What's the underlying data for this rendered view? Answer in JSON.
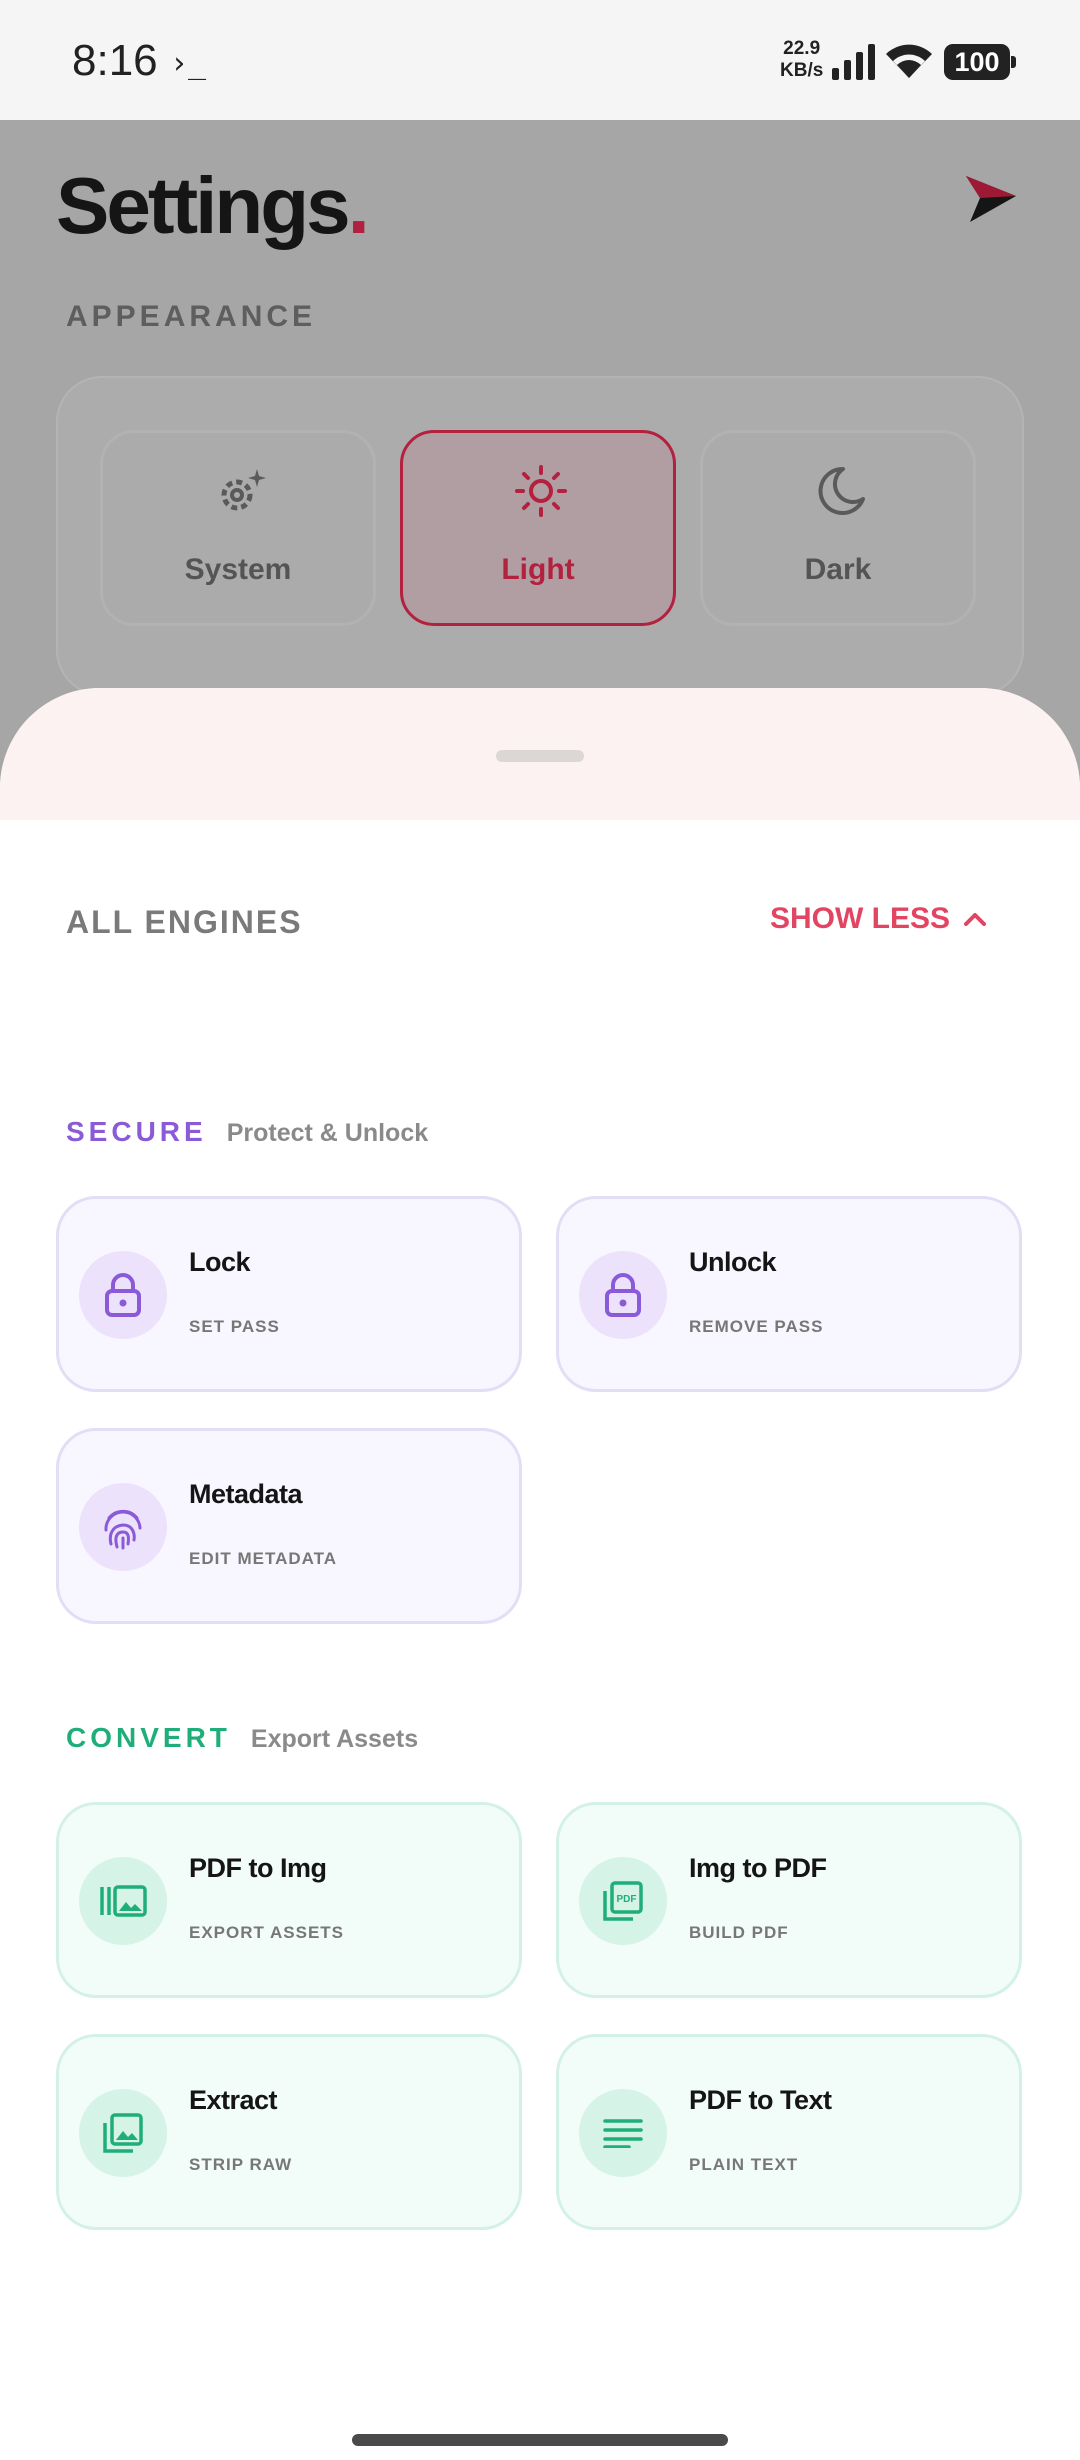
{
  "status_bar": {
    "time": "8:16",
    "prompt": "›_",
    "speed_value": "22.9",
    "speed_unit": "KB/s",
    "battery": "100"
  },
  "settings": {
    "title": "Settings",
    "title_dot": ".",
    "appearance_label": "APPEARANCE",
    "themes": [
      {
        "label": "System",
        "icon": "gear-sparkle-icon",
        "active": false
      },
      {
        "label": "Light",
        "icon": "sun-icon",
        "active": true
      },
      {
        "label": "Dark",
        "icon": "moon-icon",
        "active": false
      }
    ]
  },
  "sheet": {
    "header": "ALL ENGINES",
    "toggle": "SHOW LESS",
    "sections": [
      {
        "name": "SECURE",
        "subtitle": "Protect & Unlock",
        "color": "#8a5ad8",
        "cards": [
          {
            "title": "Lock",
            "subtitle": "SET PASS",
            "icon": "lock-icon"
          },
          {
            "title": "Unlock",
            "subtitle": "REMOVE PASS",
            "icon": "unlock-icon"
          },
          {
            "title": "Metadata",
            "subtitle": "EDIT METADATA",
            "icon": "fingerprint-icon"
          }
        ]
      },
      {
        "name": "CONVERT",
        "subtitle": "Export Assets",
        "color": "#1fae7a",
        "cards": [
          {
            "title": "PDF to Img",
            "subtitle": "EXPORT ASSETS",
            "icon": "pdf-to-image-icon"
          },
          {
            "title": "Img to PDF",
            "subtitle": "BUILD PDF",
            "icon": "image-to-pdf-icon"
          },
          {
            "title": "Extract",
            "subtitle": "STRIP RAW",
            "icon": "extract-images-icon"
          },
          {
            "title": "PDF to Text",
            "subtitle": "PLAIN TEXT",
            "icon": "text-lines-icon"
          }
        ]
      }
    ]
  },
  "colors": {
    "accent": "#e24562",
    "brand_dot": "#b02040"
  }
}
